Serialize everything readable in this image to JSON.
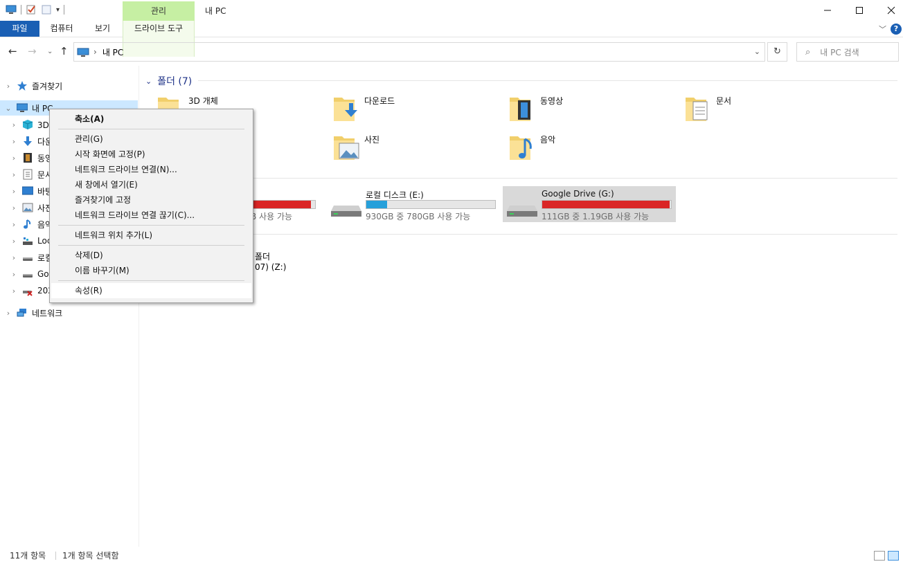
{
  "title_bar": {
    "context_tab_group": "관리",
    "window_title": "내 PC",
    "minimize": "—",
    "maximize": "☐",
    "close": "✕"
  },
  "ribbon": {
    "tabs": [
      "파일",
      "컴퓨터",
      "보기",
      "드라이브 도구"
    ],
    "help": "?"
  },
  "address_bar": {
    "breadcrumb": "내 PC",
    "search_placeholder": "내 PC 검색"
  },
  "nav_pane": {
    "items": [
      {
        "label": "즐겨찾기",
        "icon": "star-icon"
      },
      {
        "label": "내 PC",
        "icon": "computer-icon"
      },
      {
        "label": "3D 개체",
        "icon": "3d-objects-icon"
      },
      {
        "label": "다운로드",
        "icon": "download-icon"
      },
      {
        "label": "동영상",
        "icon": "video-icon"
      },
      {
        "label": "문서",
        "icon": "document-icon"
      },
      {
        "label": "바탕 화면",
        "icon": "desktop-icon"
      },
      {
        "label": "사진",
        "icon": "pictures-icon"
      },
      {
        "label": "음악",
        "icon": "music-icon"
      },
      {
        "label": "Local Disk",
        "icon": "local-disk-icon"
      },
      {
        "label": "로컬 디스크",
        "icon": "drive-icon"
      },
      {
        "label": "Google Drive",
        "icon": "drive-icon"
      },
      {
        "label": "2024",
        "icon": "disconnected-drive-icon"
      },
      {
        "label": "네트워크",
        "icon": "network-icon"
      }
    ]
  },
  "content": {
    "folders_header": "폴더 (7)",
    "folders": [
      {
        "name": "3D 개체",
        "icon": "3d-objects-folder-icon"
      },
      {
        "name": "다운로드",
        "icon": "downloads-folder-icon"
      },
      {
        "name": "동영상",
        "icon": "videos-folder-icon"
      },
      {
        "name": "문서",
        "icon": "documents-folder-icon"
      },
      {
        "name": "사진",
        "icon": "pictures-folder-icon"
      },
      {
        "name": "음악",
        "icon": "music-folder-icon"
      }
    ],
    "drives": [
      {
        "name": "",
        "info": "B 사용 가능",
        "fill_pct": 97,
        "color": "#da2626"
      },
      {
        "name": "로컬 디스크 (E:)",
        "info": "930GB 중 780GB 사용 가능",
        "fill_pct": 16,
        "color": "#26a0da"
      },
      {
        "name": "Google Drive (G:)",
        "info": "111GB 중 1.19GB 사용 가능",
        "fill_pct": 99,
        "color": "#da2626"
      }
    ],
    "network_location": {
      "name": "폴더",
      "sub": "07) (Z:)"
    }
  },
  "context_menu": {
    "items": [
      {
        "label": "축소(A)",
        "bold": true
      },
      {
        "sep": true
      },
      {
        "label": "관리(G)"
      },
      {
        "label": "시작 화면에 고정(P)"
      },
      {
        "label": "네트워크 드라이브 연결(N)..."
      },
      {
        "label": "새 창에서 열기(E)"
      },
      {
        "label": "즐겨찾기에 고정"
      },
      {
        "label": "네트워크 드라이브 연결 끊기(C)..."
      },
      {
        "sep": true
      },
      {
        "label": "네트워크 위치 추가(L)"
      },
      {
        "sep": true
      },
      {
        "label": "삭제(D)"
      },
      {
        "label": "이름 바꾸기(M)"
      },
      {
        "sep": true
      },
      {
        "label": "속성(R)",
        "hover": true
      }
    ]
  },
  "status_bar": {
    "item_count": "11개 항목",
    "selected": "1개 항목 선택함"
  },
  "colors": {
    "accent": "#1a5fb4",
    "context_tab": "#c6efa3",
    "selection": "#cce8ff",
    "usage_full": "#da2626",
    "usage_normal": "#26a0da"
  }
}
